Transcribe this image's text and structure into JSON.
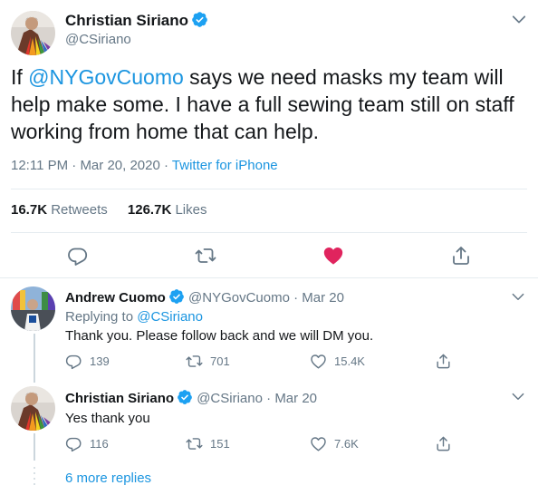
{
  "main_tweet": {
    "author_name": "Christian Siriano",
    "handle": "@CSiriano",
    "text_prefix": "If ",
    "mention": "@NYGovCuomo",
    "text_suffix": " says we need masks my team will help make some. I have a full sewing team still on staff working from home that can help.",
    "time": "12:11 PM",
    "date": "Mar 20, 2020",
    "source": "Twitter for iPhone",
    "retweets_count": "16.7K",
    "retweets_label": "Retweets",
    "likes_count": "126.7K",
    "likes_label": "Likes",
    "icons": [
      "reply-icon",
      "retweet-icon",
      "heart-filled-icon",
      "share-icon"
    ],
    "like_color": "#e0245e"
  },
  "replies": [
    {
      "author_name": "Andrew Cuomo",
      "handle": "@NYGovCuomo",
      "date": "Mar 20",
      "replying_to_label": "Replying to",
      "replying_to_handle": "@CSiriano",
      "text": "Thank you. Please follow back and we will DM you.",
      "reply_count": "139",
      "retweet_count": "701",
      "like_count": "15.4K"
    },
    {
      "author_name": "Christian Siriano",
      "handle": "@CSiriano",
      "date": "Mar 20",
      "text": "Yes thank you",
      "reply_count": "116",
      "retweet_count": "151",
      "like_count": "7.6K"
    }
  ],
  "more_replies": "6 more replies",
  "separator": "·",
  "colors": {
    "link": "#1b95e0",
    "muted": "#657786",
    "verified": "#1da1f2",
    "divider": "#e6ecf0"
  }
}
